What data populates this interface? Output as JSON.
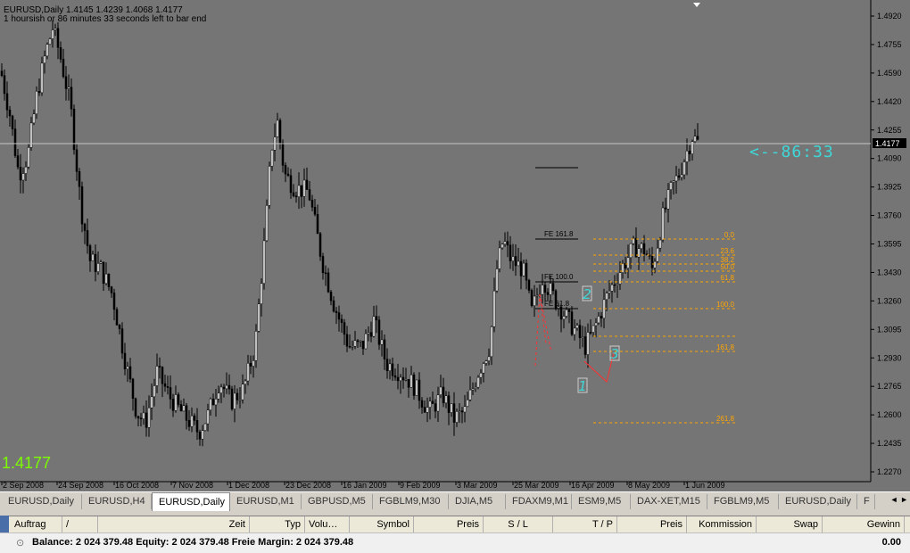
{
  "chart": {
    "header_line1": "EURUSD,Daily  1.4145 1.4239 1.4068 1.4177",
    "header_line2": "1 hoursish or 86 minutes 33 seconds left to bar end",
    "current_price_big": "1.4177",
    "countdown": "<--86:33",
    "current_price_tag": "1.4177",
    "price_labels": [
      "1.4920",
      "1.4755",
      "1.4590",
      "1.4420",
      "1.4255",
      "1.4090",
      "1.3925",
      "1.3760",
      "1.3595",
      "1.3430",
      "1.3260",
      "1.3095",
      "1.2930",
      "1.2765",
      "1.2600",
      "1.2435",
      "1.2270"
    ],
    "date_labels": [
      "2 Sep 2008",
      "24 Sep 2008",
      "16 Oct 2008",
      "7 Nov 2008",
      "1 Dec 2008",
      "23 Dec 2008",
      "16 Jan 2009",
      "9 Feb 2009",
      "3 Mar 2009",
      "25 Mar 2009",
      "16 Apr 2009",
      "8 May 2009",
      "1 Jun 2009"
    ],
    "fe_labels": [
      "FE 161.8",
      "FE 100.0",
      "FE 61.8"
    ],
    "fib_labels": [
      "0.0",
      "23.6",
      "38.2",
      "50.0",
      "61.8",
      "100.0",
      "161.8",
      "261.8"
    ],
    "wave_labels": [
      "1",
      "2",
      "3"
    ],
    "colors": {
      "background": "#757575",
      "bull": "#ffffff",
      "bear": "#000000",
      "fib": "#ffa500",
      "price_line": "#c8c8c8",
      "countdown": "#3fd8d8",
      "big_price": "#7cfc00",
      "waves": "#ff3030",
      "wave_label": "#3fd8d8"
    }
  },
  "tabs": [
    {
      "label": "EURUSD,Daily",
      "active": false
    },
    {
      "label": "EURUSD,H4",
      "active": false
    },
    {
      "label": "EURUSD,Daily",
      "active": true
    },
    {
      "label": "EURUSD,M1",
      "active": false
    },
    {
      "label": "GBPUSD,M5",
      "active": false
    },
    {
      "label": "FGBLM9,M30",
      "active": false
    },
    {
      "label": "DJIA,M5",
      "active": false
    },
    {
      "label": "FDAXM9,M1",
      "active": false
    },
    {
      "label": "ESM9,M5",
      "active": false
    },
    {
      "label": "DAX-XET,M15",
      "active": false
    },
    {
      "label": "FGBLM9,M5",
      "active": false
    },
    {
      "label": "EURUSD,Daily",
      "active": false
    },
    {
      "label": "F",
      "active": false
    }
  ],
  "tab_arrows": "◄ ►",
  "terminal": {
    "columns": [
      "Auftrag",
      "/",
      "Zeit",
      "Typ",
      "Volu…",
      "Symbol",
      "Preis",
      "S / L",
      "T / P",
      "Preis",
      "Kommission",
      "Swap",
      "Gewinn"
    ],
    "balance_text": "Balance: 2 024 379.48  Equity: 2 024 379.48  Freie Margin: 2 024 379.48",
    "balance_total": "0.00"
  }
}
